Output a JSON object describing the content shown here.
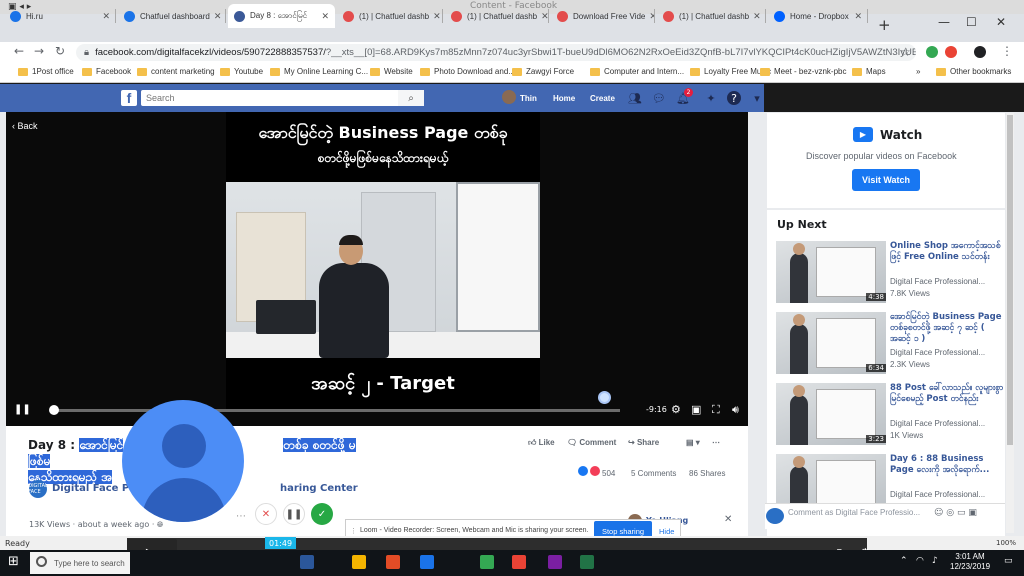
{
  "window": {
    "title": "Content - Facebook"
  },
  "tabs": [
    {
      "label": "Hi.ru",
      "active": false,
      "color": "#1a73e8"
    },
    {
      "label": "Chatfuel dashboard",
      "active": false,
      "color": "#1a73e8"
    },
    {
      "label": "Day 8 : အောင်မြင်",
      "active": true,
      "color": "#3b5998"
    },
    {
      "label": "(1) | Chatfuel dashb",
      "active": false,
      "color": "#e34c4c"
    },
    {
      "label": "(1) | Chatfuel dashb",
      "active": false,
      "color": "#e34c4c"
    },
    {
      "label": "Download Free Vide",
      "active": false,
      "color": "#e34c4c"
    },
    {
      "label": "(1) | Chatfuel dashb",
      "active": false,
      "color": "#e34c4c"
    },
    {
      "label": "Home - Dropbox",
      "active": false,
      "color": "#0061ff"
    }
  ],
  "address": {
    "url_main": "facebook.com/digitalfacekzl/videos/590722888357537/",
    "url_rest": "?__xts__[0]=68.ARD9Kys7m85zMnn7z074uc3yrSbwi1T-bueU9dDl6MO62N2RxOeEid3ZQnfB-bL7I7vlYKQCIPt4cK0ucHZigIjV5AWZtN3IyUEa-_cQE..."
  },
  "bookmarks": [
    "1Post office",
    "Facebook",
    "content marketing",
    "Youtube",
    "My Online Learning C...",
    "Website",
    "Photo Download and...",
    "Zawgyi Force",
    "Computer and Intern...",
    "Loyalty Free Music",
    "Meet - bez-vznk-pbc",
    "Maps",
    "Other bookmarks"
  ],
  "fb": {
    "search_placeholder": "Search",
    "user": "Thin",
    "home": "Home",
    "create": "Create",
    "notif_count": "2"
  },
  "video": {
    "back": "Back",
    "title_line1": "အောင်မြင်တဲ့ Business Page တစ်ခု",
    "title_line2": "စတင်ဖို့မဖြစ်မနေသိထားရမယ့်",
    "subtitle": "အဆင့် ၂ - Target",
    "time_remaining": "-9:16",
    "progress": 0.007
  },
  "post": {
    "title_a": "Day 8 : ",
    "title_b": "အောင်မြင်",
    "title_c": "တစ်ခု စတင်ဖို့ မဖြစ်မ",
    "title_d": "နေသိထားရမည့် အ",
    "like": "Like",
    "comment": "Comment",
    "share": "Share",
    "reaction_count": "504",
    "comments": "5 Comments",
    "shares": "86 Shares",
    "page_name": "Digital Face Pro",
    "sharing_center": "haring Center",
    "page_logo": "DIGITAL FACE",
    "views": "13K Views",
    "age": "about a week ago"
  },
  "watch": {
    "title": "Watch",
    "desc": "Discover popular videos on Facebook",
    "button": "Visit Watch"
  },
  "up_next": {
    "heading": "Up Next",
    "items": [
      {
        "title": "Online Shop အကောင့်အသစ်ဖြင့် Free Online သင်တန်း",
        "channel": "Digital Face Professional...",
        "views": "7.8K Views",
        "duration": "4:38"
      },
      {
        "title": "အောင်မြင်တဲ့ Business Page တစ်ခုစတင်ဖို့ အဆင့် ၇ ဆင့် ( အဆင့် ၁ )",
        "channel": "Digital Face Professional...",
        "views": "2.3K Views",
        "duration": "6:34"
      },
      {
        "title": "88 Post ခေါ်လာသည်။ လူများစွာမြင်စေမည့် Post တင်နည်း",
        "channel": "Digital Face Professional...",
        "views": "1K Views",
        "duration": "3:23"
      },
      {
        "title": "Day 6 : 88 Business Page လေးကို အလိုရောက်...",
        "channel": "Digital Face Professional...",
        "views": "19K Views",
        "duration": ""
      }
    ]
  },
  "comment_placeholder": "Comment as Digital Face Professio...",
  "commenter_name": "Ye Hliang",
  "loom": {
    "text": "Loom - Video Recorder: Screen, Webcam and Mic is sharing your screen.",
    "stop": "Stop sharing",
    "hide": "Hide"
  },
  "statusbar": {
    "text": "Ready",
    "zoom": "100%"
  },
  "player": {
    "time": "01:49",
    "progress": 0.14
  },
  "taskbar": {
    "search": "Type here to search",
    "time": "3:01 AM",
    "date": "12/23/2019"
  },
  "colors": {
    "fb_blue": "#4267b2",
    "link": "#385898",
    "accent": "#1877f2",
    "loom_blue": "#1a73e8"
  }
}
